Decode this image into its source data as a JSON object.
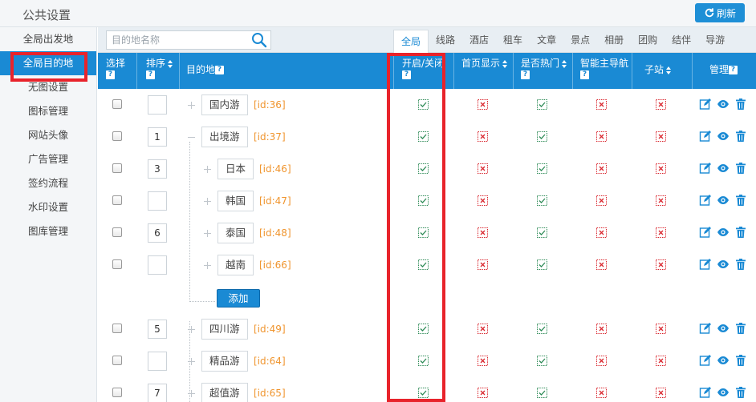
{
  "header": {
    "title": "公共设置",
    "refresh_label": "刷新"
  },
  "sidebar": {
    "items": [
      {
        "label": "全局出发地",
        "active": false
      },
      {
        "label": "全局目的地",
        "active": true
      },
      {
        "label": "无图设置",
        "active": false
      },
      {
        "label": "图标管理",
        "active": false
      },
      {
        "label": "网站头像",
        "active": false
      },
      {
        "label": "广告管理",
        "active": false
      },
      {
        "label": "签约流程",
        "active": false
      },
      {
        "label": "水印设置",
        "active": false
      },
      {
        "label": "图库管理",
        "active": false
      }
    ]
  },
  "search": {
    "placeholder": "目的地名称",
    "value": ""
  },
  "tabs": [
    {
      "label": "全局",
      "active": true
    },
    {
      "label": "线路",
      "active": false
    },
    {
      "label": "酒店",
      "active": false
    },
    {
      "label": "租车",
      "active": false
    },
    {
      "label": "文章",
      "active": false
    },
    {
      "label": "景点",
      "active": false
    },
    {
      "label": "相册",
      "active": false
    },
    {
      "label": "团购",
      "active": false
    },
    {
      "label": "结伴",
      "active": false
    },
    {
      "label": "导游",
      "active": false
    }
  ],
  "table": {
    "columns": {
      "select": "选择",
      "order": "排序",
      "destination": "目的地",
      "open_close": "开启/关闭",
      "homepage": "首页显示",
      "hot": "是否热门",
      "main_nav": "智能主导航",
      "substation": "子站",
      "manage": "管理"
    },
    "help_glyph": "?",
    "add_label": "添加",
    "rows": [
      {
        "order": "",
        "name": "国内游",
        "id": "[id:36]",
        "level": 0,
        "expanded": false,
        "open": true,
        "home": false,
        "hot": true,
        "nav": false,
        "sub": false
      },
      {
        "order": "1",
        "name": "出境游",
        "id": "[id:37]",
        "level": 0,
        "expanded": true,
        "open": true,
        "home": false,
        "hot": true,
        "nav": false,
        "sub": false
      },
      {
        "order": "3",
        "name": "日本",
        "id": "[id:46]",
        "level": 1,
        "expanded": false,
        "open": true,
        "home": false,
        "hot": true,
        "nav": false,
        "sub": false
      },
      {
        "order": "",
        "name": "韩国",
        "id": "[id:47]",
        "level": 1,
        "expanded": false,
        "open": true,
        "home": false,
        "hot": true,
        "nav": false,
        "sub": false
      },
      {
        "order": "6",
        "name": "泰国",
        "id": "[id:48]",
        "level": 1,
        "expanded": false,
        "open": true,
        "home": false,
        "hot": true,
        "nav": false,
        "sub": false
      },
      {
        "order": "",
        "name": "越南",
        "id": "[id:66]",
        "level": 1,
        "expanded": false,
        "open": true,
        "home": false,
        "hot": true,
        "nav": false,
        "sub": false
      },
      {
        "order": "5",
        "name": "四川游",
        "id": "[id:49]",
        "level": 0,
        "expanded": false,
        "open": true,
        "home": false,
        "hot": true,
        "nav": false,
        "sub": false
      },
      {
        "order": "",
        "name": "精品游",
        "id": "[id:64]",
        "level": 0,
        "expanded": false,
        "open": true,
        "home": false,
        "hot": true,
        "nav": false,
        "sub": false
      },
      {
        "order": "7",
        "name": "超值游",
        "id": "[id:65]",
        "level": 0,
        "expanded": false,
        "open": true,
        "home": false,
        "hot": true,
        "nav": false,
        "sub": false
      }
    ]
  },
  "colors": {
    "accent": "#1a8ad4",
    "check_green": "#2e8b57",
    "cross_red": "#d9262e",
    "id_orange": "#f0952e",
    "annotation": "#e8232b"
  }
}
